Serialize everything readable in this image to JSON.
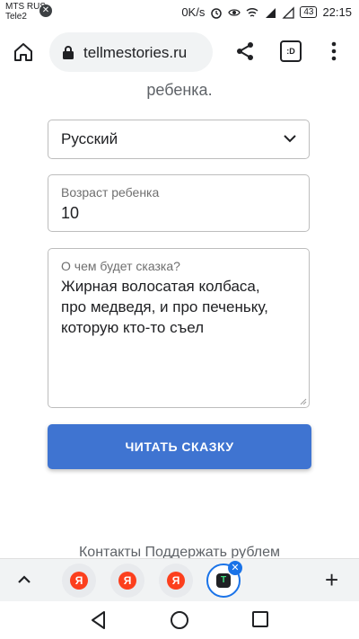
{
  "status": {
    "carrier1": "MTS RUS",
    "carrier2": "Tele2",
    "speed": "0K/s",
    "battery": "43",
    "time": "22:15"
  },
  "browser": {
    "url": "tellmestories.ru",
    "tab_switcher_label": ":D"
  },
  "page": {
    "top_text": "ребенка.",
    "language_select": {
      "value": "Русский"
    },
    "age_field": {
      "label": "Возраст ребенка",
      "value": "10"
    },
    "story_field": {
      "label": "О чем будет сказка?",
      "value": "Жирная волосатая колбаса,\nпро медведя, и про печеньку,\nкоторую кто-то съел"
    },
    "cta_label": "ЧИТАТЬ СКАЗКУ",
    "footer_links": "Контакты   Поддержать рублем"
  },
  "tabs": {
    "items": [
      {
        "label": "Я"
      },
      {
        "label": "Я"
      },
      {
        "label": "Я"
      }
    ],
    "active": {
      "label": "T"
    }
  }
}
